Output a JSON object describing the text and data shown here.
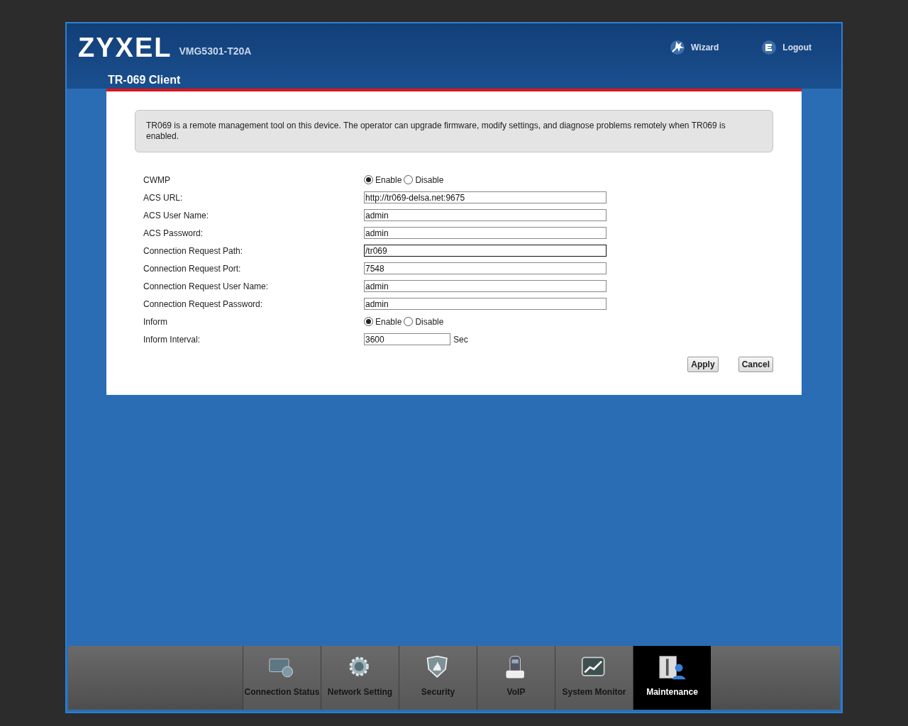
{
  "header": {
    "brand": "ZYXEL",
    "model": "VMG5301-T20A",
    "links": [
      {
        "label": "Wizard"
      },
      {
        "label": "Logout"
      }
    ]
  },
  "page_title": "TR-069 Client",
  "info": "TR069 is a remote management tool on this device. The operator can upgrade firmware, modify settings, and diagnose problems remotely when TR069 is enabled.",
  "fields": [
    {
      "kind": "radio",
      "label": "CWMP",
      "options": [
        {
          "label": "Enable",
          "selected": true
        },
        {
          "label": "Disable",
          "selected": false
        }
      ]
    },
    {
      "kind": "text",
      "label": "ACS URL:",
      "value": "http://tr069-delsa.net:9675",
      "focused": false
    },
    {
      "kind": "text",
      "label": "ACS User Name:",
      "value": "admin",
      "focused": false
    },
    {
      "kind": "text",
      "label": "ACS Password:",
      "value": "admin",
      "focused": false
    },
    {
      "kind": "text",
      "label": "Connection Request Path:",
      "value": "/tr069",
      "focused": true
    },
    {
      "kind": "text",
      "label": "Connection Request Port:",
      "value": "7548",
      "focused": false
    },
    {
      "kind": "text",
      "label": "Connection Request User Name:",
      "value": "admin",
      "focused": false
    },
    {
      "kind": "text",
      "label": "Connection Request Password:",
      "value": "admin",
      "focused": false
    },
    {
      "kind": "radio",
      "label": "Inform",
      "options": [
        {
          "label": "Enable",
          "selected": true
        },
        {
          "label": "Disable",
          "selected": false
        }
      ]
    },
    {
      "kind": "short",
      "label": "Inform Interval:",
      "value": "3600",
      "unit": "Sec",
      "focused": false
    }
  ],
  "buttons": [
    "Apply",
    "Cancel"
  ],
  "nav": [
    {
      "label": "Connection Status",
      "selected": false
    },
    {
      "label": "Network Setting",
      "selected": false
    },
    {
      "label": "Security",
      "selected": false
    },
    {
      "label": "VoIP",
      "selected": false
    },
    {
      "label": "System Monitor",
      "selected": false
    },
    {
      "label": "Maintenance",
      "selected": true
    }
  ]
}
